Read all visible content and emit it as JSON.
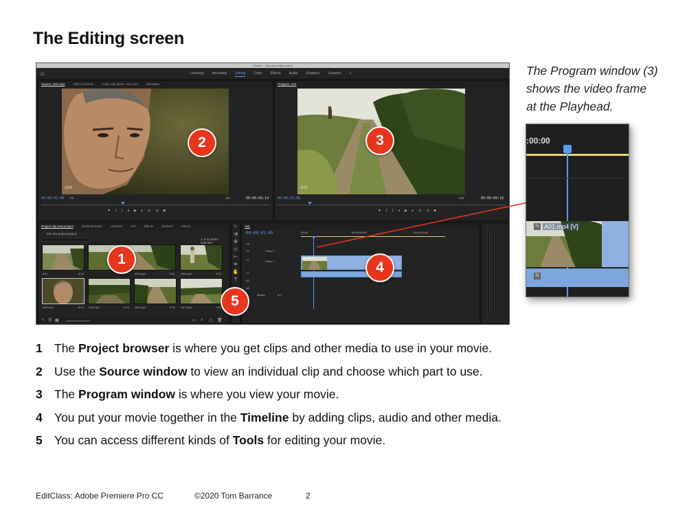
{
  "title": "The Editing screen",
  "app": {
    "path": "/Users/...../My new project.prproj",
    "workspaces": [
      "Learning",
      "Assembly",
      "Editing",
      "Color",
      "Effects",
      "Audio",
      "Graphics",
      "Libraries"
    ],
    "workspaces_more": "»",
    "active_workspace": "Editing",
    "source_tabs": [
      "Source: A04.mp4",
      "Effect Controls",
      "Audio Clip Mixer: A04.mp4",
      "Metadata"
    ],
    "program_tab": "Program: A01",
    "source_clip_label": "A04",
    "program_clip_label": "A01",
    "source_tc_left": "00:00:02:00",
    "source_fit": "Fit",
    "source_ratio": "1/2",
    "source_tc_right": "00:00:06:14",
    "program_tc_left": "00:00:01:05",
    "program_fit": "Full",
    "program_tc_right": "00:00:08:18",
    "project_tabs": [
      "Project: My new project",
      "Media Browser",
      "Libraries",
      "Info",
      "Effects",
      "Markers",
      "History"
    ],
    "project_file": "My new project.prproj",
    "items_selected": "1 of 42 items selected",
    "clips": [
      {
        "name": "A01",
        "dur": "6:18"
      },
      {
        "name": "A02.mp4",
        "dur": "7:06"
      },
      {
        "name": "A03.mp4",
        "dur": "2:23"
      },
      {
        "name": "A04.mp4",
        "dur": "6:14"
      },
      {
        "name": "A05.mp4",
        "dur": "5:13"
      },
      {
        "name": "A06.mp4",
        "dur": "8:04"
      },
      {
        "name": "A07.mp4",
        "dur": "7:09"
      }
    ],
    "timeline_tab": "A01",
    "timeline_tc": "00:00:01:05",
    "ruler": [
      "00:00",
      "00:00:05:00",
      "00:00:10:00"
    ],
    "tracks": [
      "V3",
      "V2",
      "V1",
      "A1",
      "A2",
      "A3",
      "Master"
    ],
    "track_names": [
      "Video 2",
      "Video 1"
    ],
    "master_value": "0.0",
    "clip_name": "A01.mp4 [V]"
  },
  "badges": [
    "1",
    "2",
    "3",
    "4",
    "5"
  ],
  "caption": [
    "The Program window (3)",
    "shows the video frame",
    "at the Playhead."
  ],
  "zoom": {
    "timecode": ":00:00",
    "clip_label": "A01.mp4 [V]",
    "fx": "fx"
  },
  "list": [
    {
      "num": "1",
      "pre": "The ",
      "bold": "Project browser",
      "post": " is where you get clips and other media to use in your movie."
    },
    {
      "num": "2",
      "pre": "Use the ",
      "bold": "Source window",
      "post": " to view an individual clip and choose which part to use."
    },
    {
      "num": "3",
      "pre": "The ",
      "bold": "Program window",
      "post": " is where you view your movie."
    },
    {
      "num": "4",
      "pre": "You put your movie together in the ",
      "bold": "Timeline",
      "post": " by adding clips, audio and other media."
    },
    {
      "num": "5",
      "pre": "You can access different kinds of ",
      "bold": "Tools",
      "post": " for editing your movie."
    }
  ],
  "footer": {
    "left": "EditClass: Adobe Premiere Pro CC",
    "center": "©2020 Tom Barrance",
    "page": "2"
  },
  "colors": {
    "badge": "#e8361e",
    "accent_blue": "#5d9cec",
    "clip_blue": "#8fb1e0",
    "panel": "#232323"
  }
}
